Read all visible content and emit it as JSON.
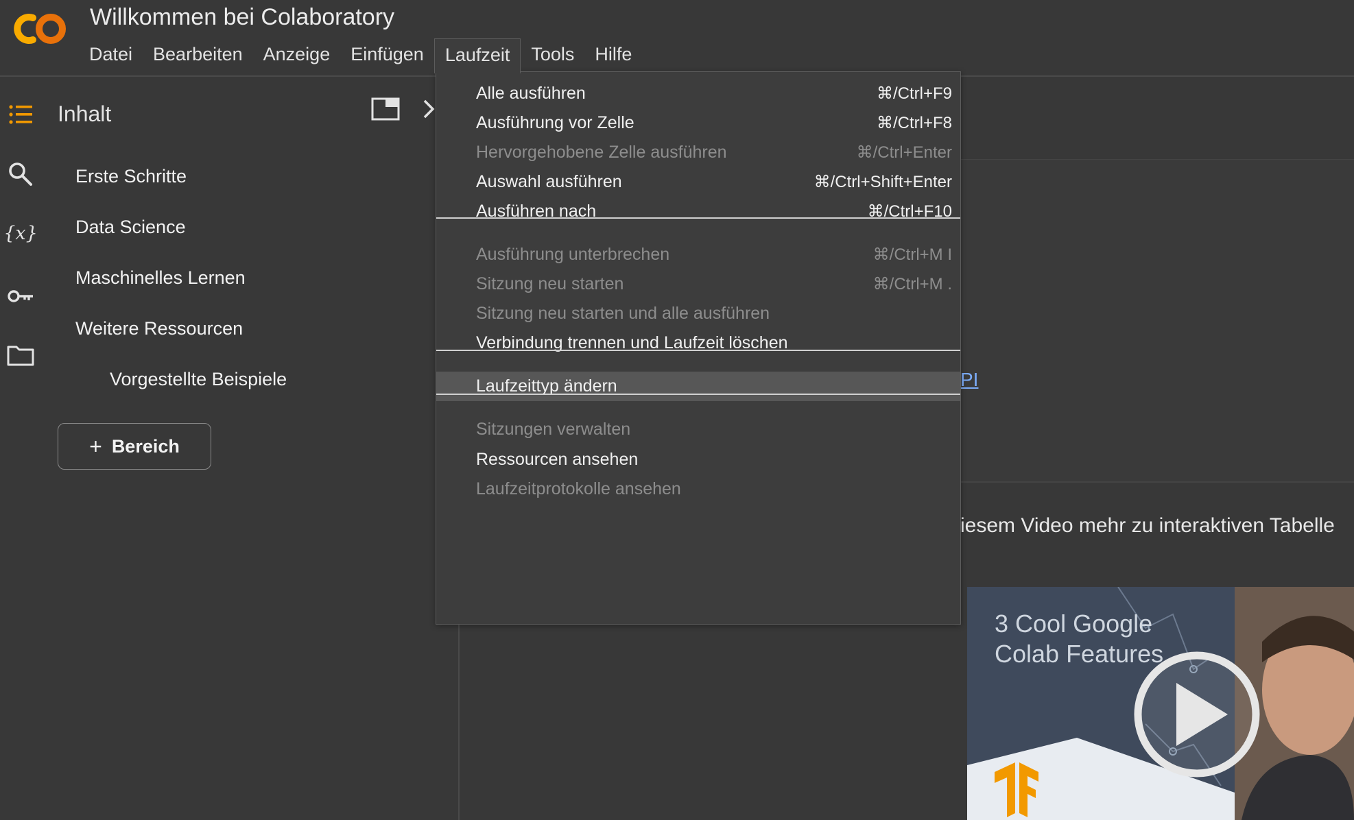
{
  "app": {
    "logo_text": "CO",
    "title": "Willkommen bei Colaboratory"
  },
  "menubar": {
    "items": [
      "Datei",
      "Bearbeiten",
      "Anzeige",
      "Einfügen",
      "Laufzeit",
      "Tools",
      "Hilfe"
    ],
    "active": "Laufzeit"
  },
  "sidebar": {
    "toc_title": "Inhalt",
    "toc_items": [
      "Erste Schritte",
      "Data Science",
      "Maschinelles Lernen",
      "Weitere Ressourcen",
      "Vorgestellte Beispiele"
    ],
    "add_section_label": "Bereich",
    "rail_icons": [
      "toc-icon",
      "search-icon",
      "variables-icon",
      "key-icon",
      "folder-icon"
    ]
  },
  "dropdown": {
    "groups": [
      [
        {
          "label": "Alle ausführen",
          "shortcut": "⌘/Ctrl+F9",
          "enabled": true
        },
        {
          "label": "Ausführung vor Zelle",
          "shortcut": "⌘/Ctrl+F8",
          "enabled": true
        },
        {
          "label": "Hervorgehobene Zelle ausführen",
          "shortcut": "⌘/Ctrl+Enter",
          "enabled": false
        },
        {
          "label": "Auswahl ausführen",
          "shortcut": "⌘/Ctrl+Shift+Enter",
          "enabled": true
        },
        {
          "label": "Ausführen nach",
          "shortcut": "⌘/Ctrl+F10",
          "enabled": true
        }
      ],
      [
        {
          "label": "Ausführung unterbrechen",
          "shortcut": "⌘/Ctrl+M I",
          "enabled": false
        },
        {
          "label": "Sitzung neu starten",
          "shortcut": "⌘/Ctrl+M .",
          "enabled": false
        },
        {
          "label": "Sitzung neu starten und alle ausführen",
          "shortcut": "",
          "enabled": false
        },
        {
          "label": "Verbindung trennen und Laufzeit löschen",
          "shortcut": "",
          "enabled": true
        }
      ],
      [
        {
          "label": "Laufzeittyp ändern",
          "shortcut": "",
          "enabled": true,
          "highlighted": true
        }
      ],
      [
        {
          "label": "Sitzungen verwalten",
          "shortcut": "",
          "enabled": false
        },
        {
          "label": "Ressourcen ansehen",
          "shortcut": "",
          "enabled": true
        },
        {
          "label": "Laufzeitprotokolle ansehen",
          "shortcut": "",
          "enabled": false
        }
      ]
    ]
  },
  "main": {
    "link_fragment": "PI",
    "video_text": "iesem Video mehr zu interaktiven Tabelle",
    "video_title_line1": "3 Cool Google",
    "video_title_line2": "Colab Features"
  },
  "colors": {
    "background": "#383838",
    "menu_bg": "#3d3d3d",
    "highlight": "#575757",
    "logo_orange": "#f9ab00",
    "logo_orange_dark": "#e8710a",
    "link": "#7cacf8",
    "disabled_text": "#8d8d8d"
  }
}
